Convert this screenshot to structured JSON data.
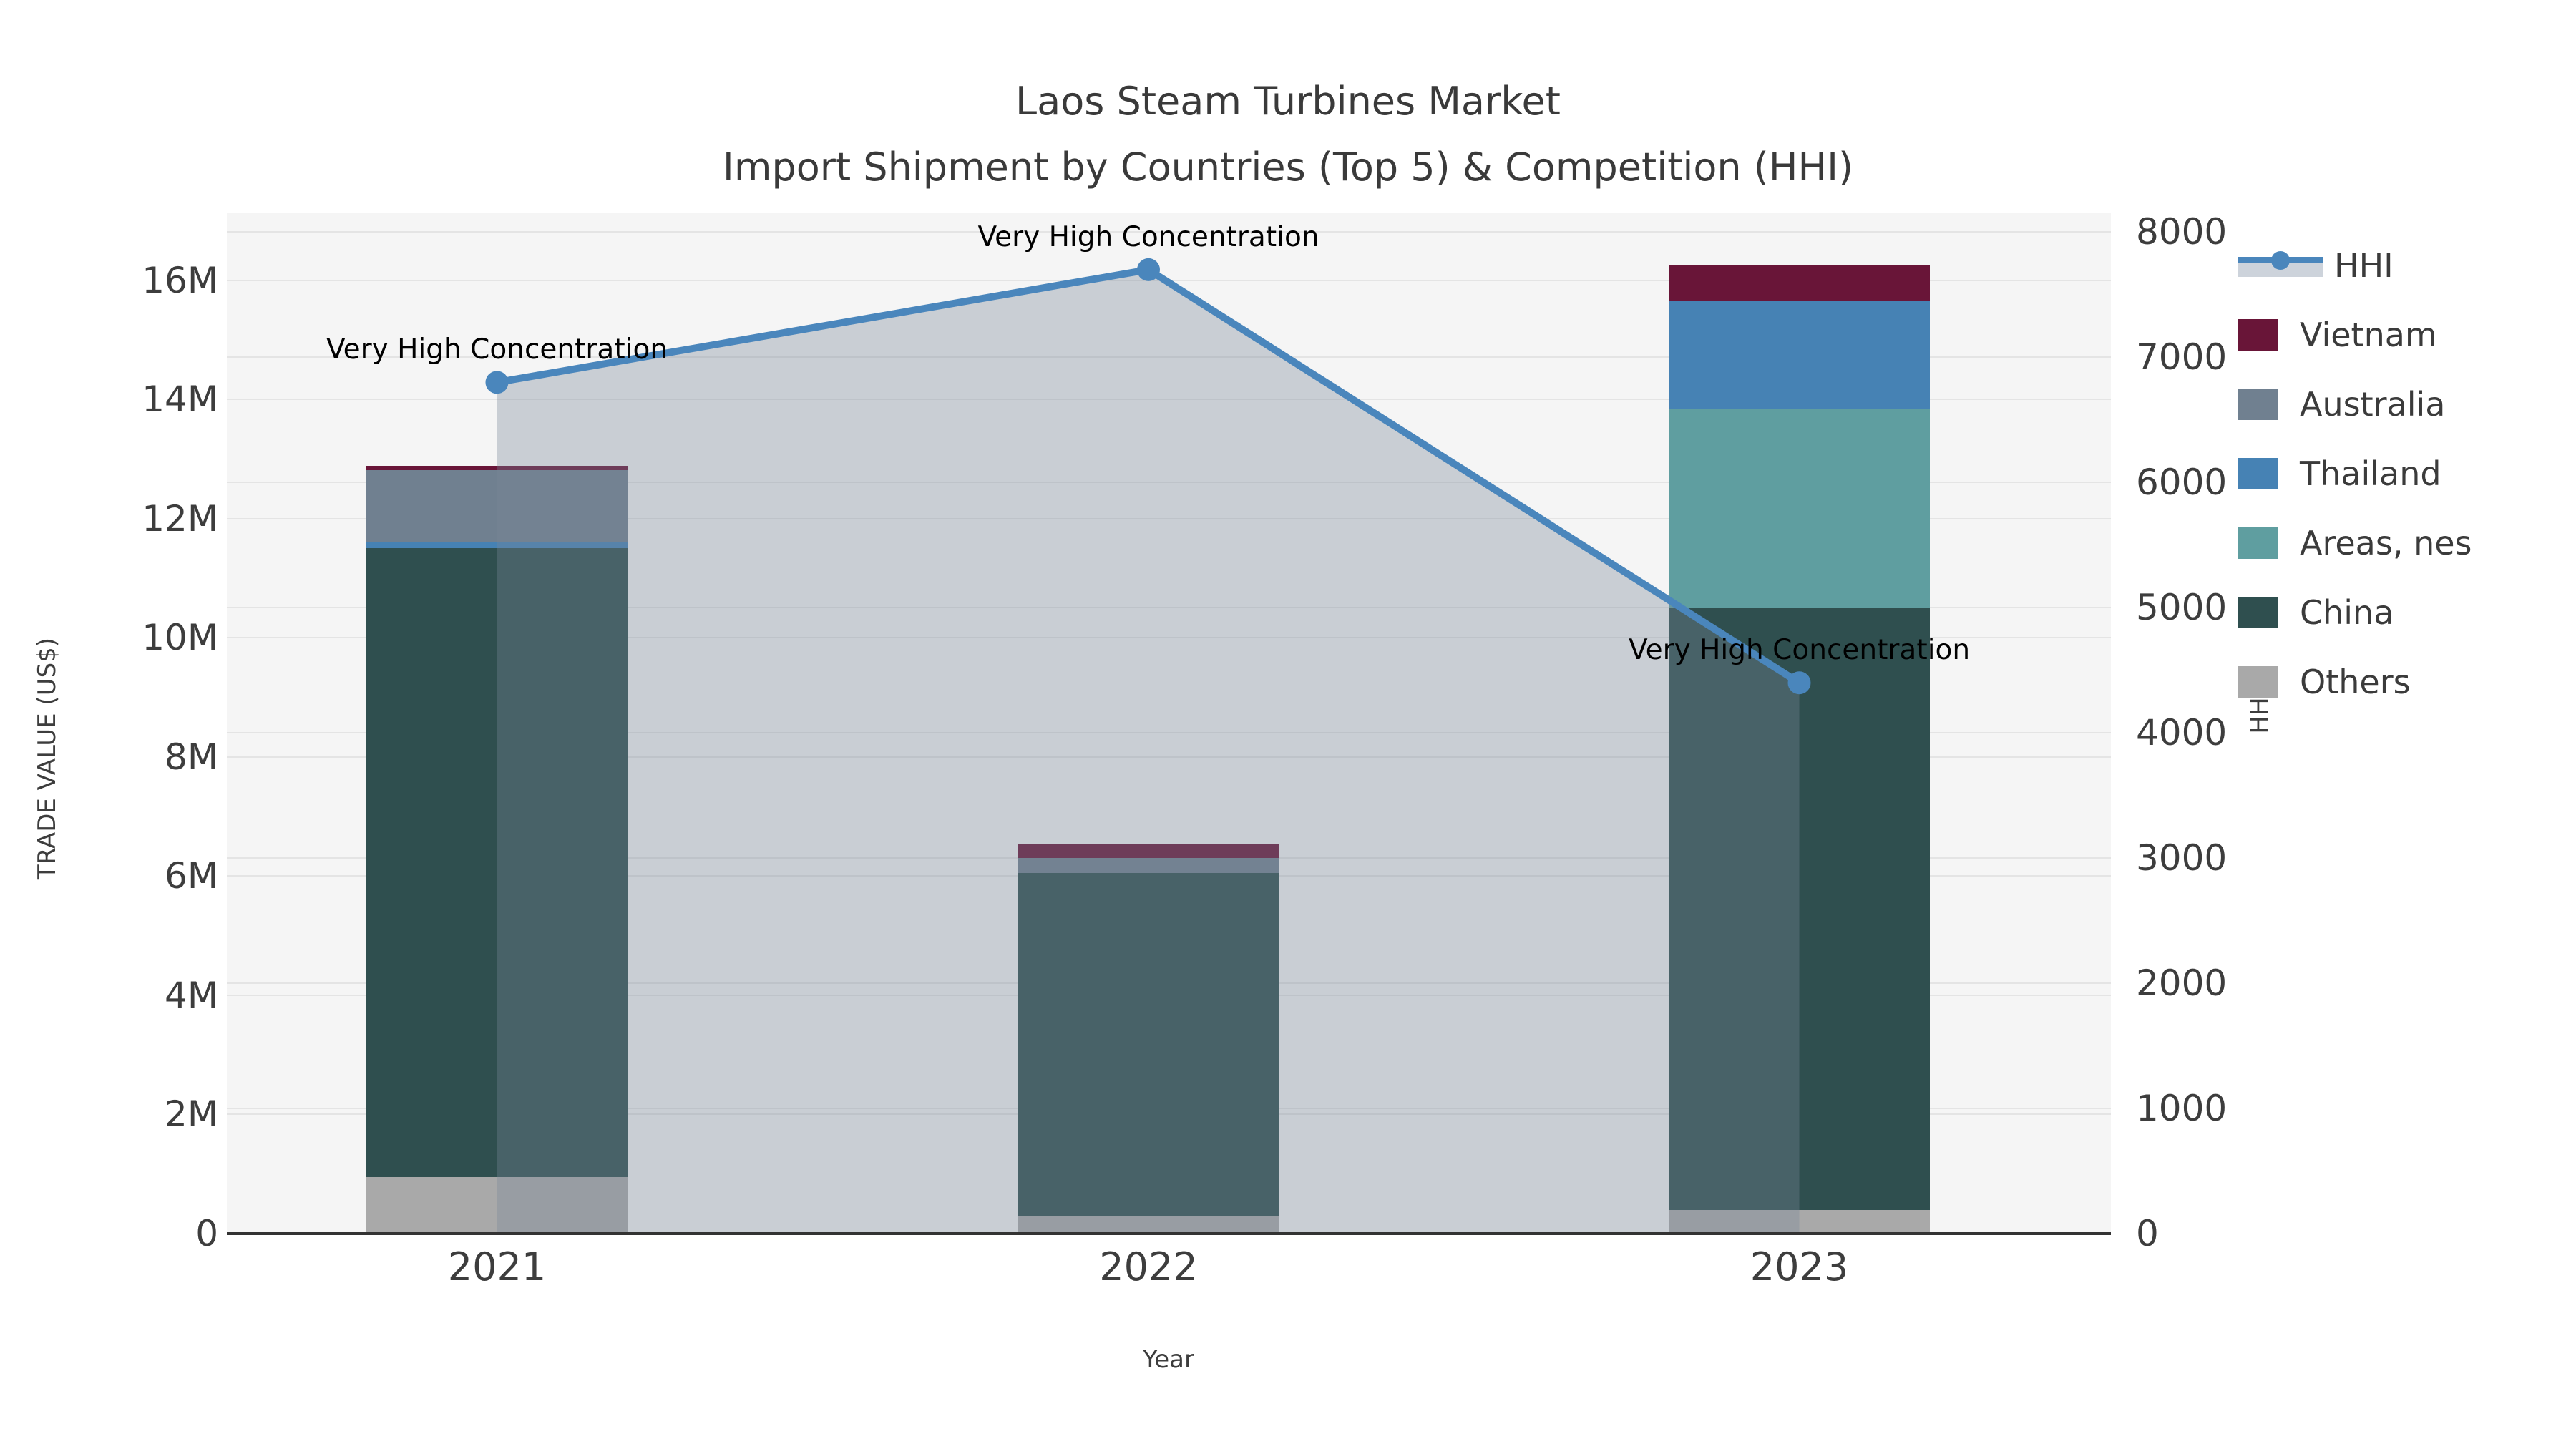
{
  "title": {
    "line1": "Laos Steam Turbines Market",
    "line2": "Import Shipment by Countries (Top 5) & Competition (HHI)"
  },
  "colors": {
    "figure_background": "#ffffff",
    "plot_background": "#f5f5f5",
    "gridline": "#e4e4e4",
    "axis_line": "#333333",
    "text": "#3d3d3d",
    "hhi_line": "#4a86bc",
    "hhi_area_fill": "rgba(119,136,153,0.35)"
  },
  "chart_data": {
    "type": "bar",
    "stacked": true,
    "title": "Laos Steam Turbines Market — Import Shipment by Countries (Top 5) & Competition (HHI)",
    "categories": [
      "2021",
      "2022",
      "2023"
    ],
    "unit": "millions of US$",
    "series": [
      {
        "name": "Vietnam",
        "color": "#691538",
        "values": [
          0.08,
          0.25,
          0.6
        ]
      },
      {
        "name": "Australia",
        "color": "#708090",
        "values": [
          1.2,
          0.25,
          0.0
        ]
      },
      {
        "name": "Thailand",
        "color": "#4682b4",
        "values": [
          0.11,
          0.0,
          1.8
        ]
      },
      {
        "name": "Areas, nes",
        "color": "#5f9ea0",
        "values": [
          0.0,
          0.0,
          3.35
        ]
      },
      {
        "name": "China",
        "color": "#2f4f4f",
        "values": [
          10.55,
          5.75,
          10.1
        ]
      },
      {
        "name": "Others",
        "color": "#a9a9a9",
        "values": [
          0.95,
          0.3,
          0.4
        ]
      }
    ],
    "stack_order_bottom_to_top": [
      "Others",
      "China",
      "Areas, nes",
      "Thailand",
      "Australia",
      "Vietnam"
    ],
    "bar_totals": [
      12.89,
      6.55,
      16.25
    ],
    "line_series": {
      "name": "HHI",
      "axis": "right",
      "color": "#4a86bc",
      "fill_color": "rgba(119,136,153,0.35)",
      "values": [
        6800,
        7700,
        4400
      ]
    },
    "annotations": {
      "text": "Very High Concentration",
      "per_point": [
        true,
        true,
        true
      ]
    },
    "xlabel": "Year",
    "ylabel": "TRADE VALUE (US$)",
    "y2label": "HHI",
    "y_ticks": [
      "0",
      "2M",
      "4M",
      "6M",
      "8M",
      "10M",
      "12M",
      "14M",
      "16M"
    ],
    "y2_ticks": [
      "0",
      "1000",
      "2000",
      "3000",
      "4000",
      "5000",
      "6000",
      "7000",
      "8000"
    ],
    "ylim": [
      0,
      17.125
    ],
    "y2lim": [
      0,
      8151
    ],
    "grid": true,
    "legend_position": "right",
    "legend_items": [
      "HHI",
      "Vietnam",
      "Australia",
      "Thailand",
      "Areas, nes",
      "China",
      "Others"
    ]
  }
}
